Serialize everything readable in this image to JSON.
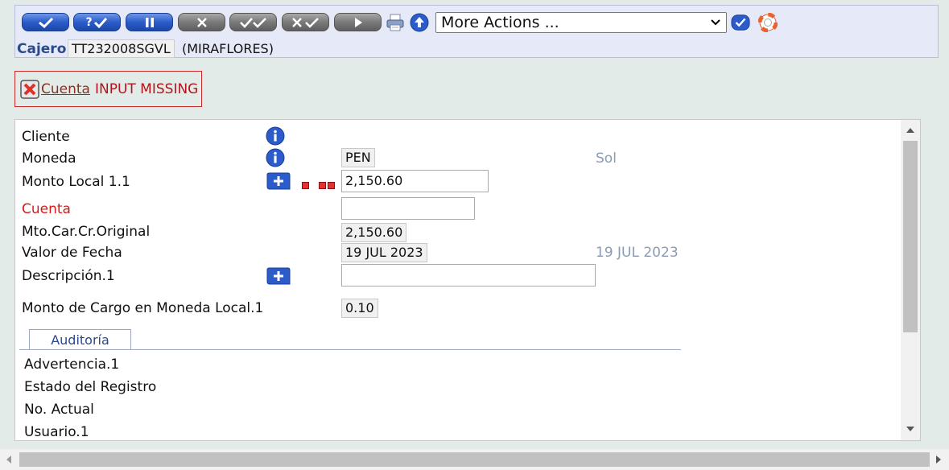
{
  "toolbar": {
    "buttons": [
      {
        "name": "commit-button",
        "label": "",
        "icon": "check-icon",
        "color": "blue"
      },
      {
        "name": "validate-button",
        "label": "?",
        "icon": "question-check-icon",
        "color": "blue"
      },
      {
        "name": "hold-button",
        "label": "",
        "icon": "pause-icon",
        "color": "blue"
      },
      {
        "name": "delete-button",
        "label": "",
        "icon": "x-icon",
        "color": "gray"
      },
      {
        "name": "authorise-button",
        "label": "",
        "icon": "double-check-icon",
        "color": "gray"
      },
      {
        "name": "reverse-button",
        "label": "",
        "icon": "x-check-icon",
        "color": "gray"
      },
      {
        "name": "next-button",
        "label": "",
        "icon": "play-icon",
        "color": "gray"
      }
    ],
    "more_actions_value": "More Actions ...",
    "cajero_label": "Cajero",
    "cajero_value": "TT232008SGVL",
    "cajero_location": "(MIRAFLORES)"
  },
  "error": {
    "link_text": "Cuenta",
    "message": "INPUT MISSING"
  },
  "form": {
    "cliente_label": "Cliente",
    "moneda_label": "Moneda",
    "moneda_value": "PEN",
    "moneda_desc": "Sol",
    "monto_label": "Monto Local 1.1",
    "monto_value": "2,150.60",
    "cuenta_label": "Cuenta",
    "cuenta_value": "",
    "mto_label": "Mto.Car.Cr.Original",
    "mto_value": "2,150.60",
    "fecha_label": "Valor de Fecha",
    "fecha_value": "19 JUL 2023",
    "fecha_desc": "19 JUL 2023",
    "descripcion_label": "Descripción.1",
    "descripcion_value": "",
    "cargo_label": "Monto de Cargo en Moneda Local.1",
    "cargo_value": "0.10"
  },
  "audit": {
    "tab_label": "Auditoría",
    "items": [
      "Advertencia.1",
      "Estado del Registro",
      "No. Actual",
      "Usuario.1"
    ]
  },
  "colors": {
    "accent_blue": "#2b5cc9",
    "error_red": "#b3141b",
    "label_blue": "#2a4a8a"
  }
}
